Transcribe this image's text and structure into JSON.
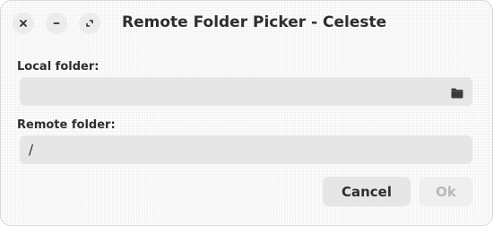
{
  "window": {
    "title": "Remote Folder Picker - Celeste"
  },
  "titlebar": {
    "close_icon": "close-icon",
    "minimize_icon": "minimize-icon",
    "maximize_icon": "maximize-icon"
  },
  "form": {
    "local_label": "Local folder:",
    "local_value": "",
    "local_browse_icon": "folder-icon",
    "remote_label": "Remote folder:",
    "remote_value": "/"
  },
  "actions": {
    "cancel_label": "Cancel",
    "ok_label": "Ok",
    "ok_enabled": false
  },
  "colors": {
    "text": "#2e2e2e",
    "input_bg": "#e6e6e6",
    "disabled_text": "#b8b8b8"
  }
}
